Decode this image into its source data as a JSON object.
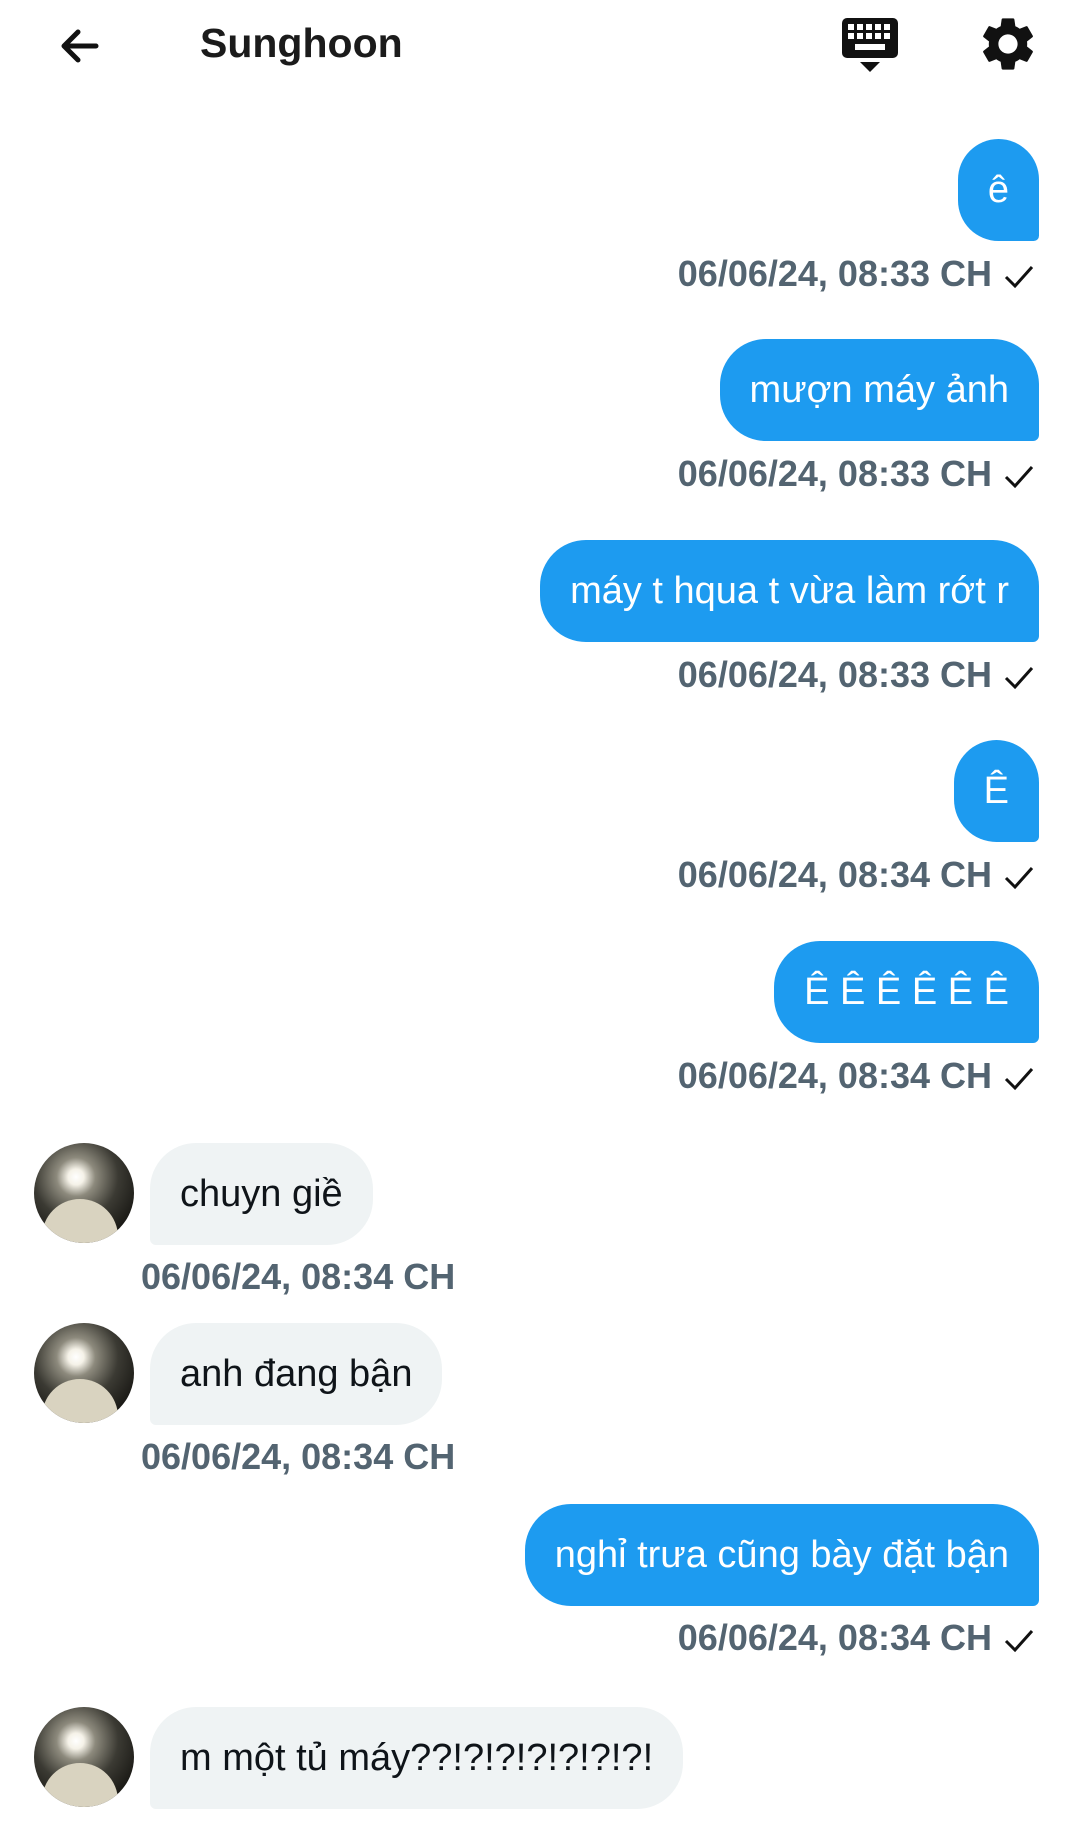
{
  "header": {
    "contact_name": "Sunghoon",
    "back_icon": "arrow-left-icon",
    "keyboard_icon": "keyboard-icon",
    "settings_icon": "gear-icon"
  },
  "colors": {
    "outgoing_bubble": "#1d9bf0",
    "incoming_bubble": "#eff3f4",
    "timestamp": "#536471"
  },
  "messages": [
    {
      "direction": "out",
      "text": "ê",
      "time": "06/06/24, 08:33 CH",
      "read_icon": "check-icon"
    },
    {
      "direction": "out",
      "text": "mượn máy ảnh",
      "time": "06/06/24, 08:33 CH",
      "read_icon": "check-icon"
    },
    {
      "direction": "out",
      "text": "máy t hqua t vừa làm rớt r",
      "time": "06/06/24, 08:33 CH",
      "read_icon": "check-icon"
    },
    {
      "direction": "out",
      "text": "Ê",
      "time": "06/06/24, 08:34 CH",
      "read_icon": "check-icon"
    },
    {
      "direction": "out",
      "text": "Ê Ê Ê Ê Ê Ê",
      "time": "06/06/24, 08:34 CH",
      "read_icon": "check-icon"
    },
    {
      "direction": "in",
      "text": "chuyn giề",
      "time": "06/06/24, 08:34 CH"
    },
    {
      "direction": "in",
      "text": "anh đang bận",
      "time": "06/06/24, 08:34 CH"
    },
    {
      "direction": "out",
      "text": "nghỉ trưa cũng bày đặt bận",
      "time": "06/06/24, 08:34 CH",
      "read_icon": "check-icon"
    },
    {
      "direction": "in",
      "text": "m một tủ máy??!?!?!?!?!?!?!"
    }
  ]
}
